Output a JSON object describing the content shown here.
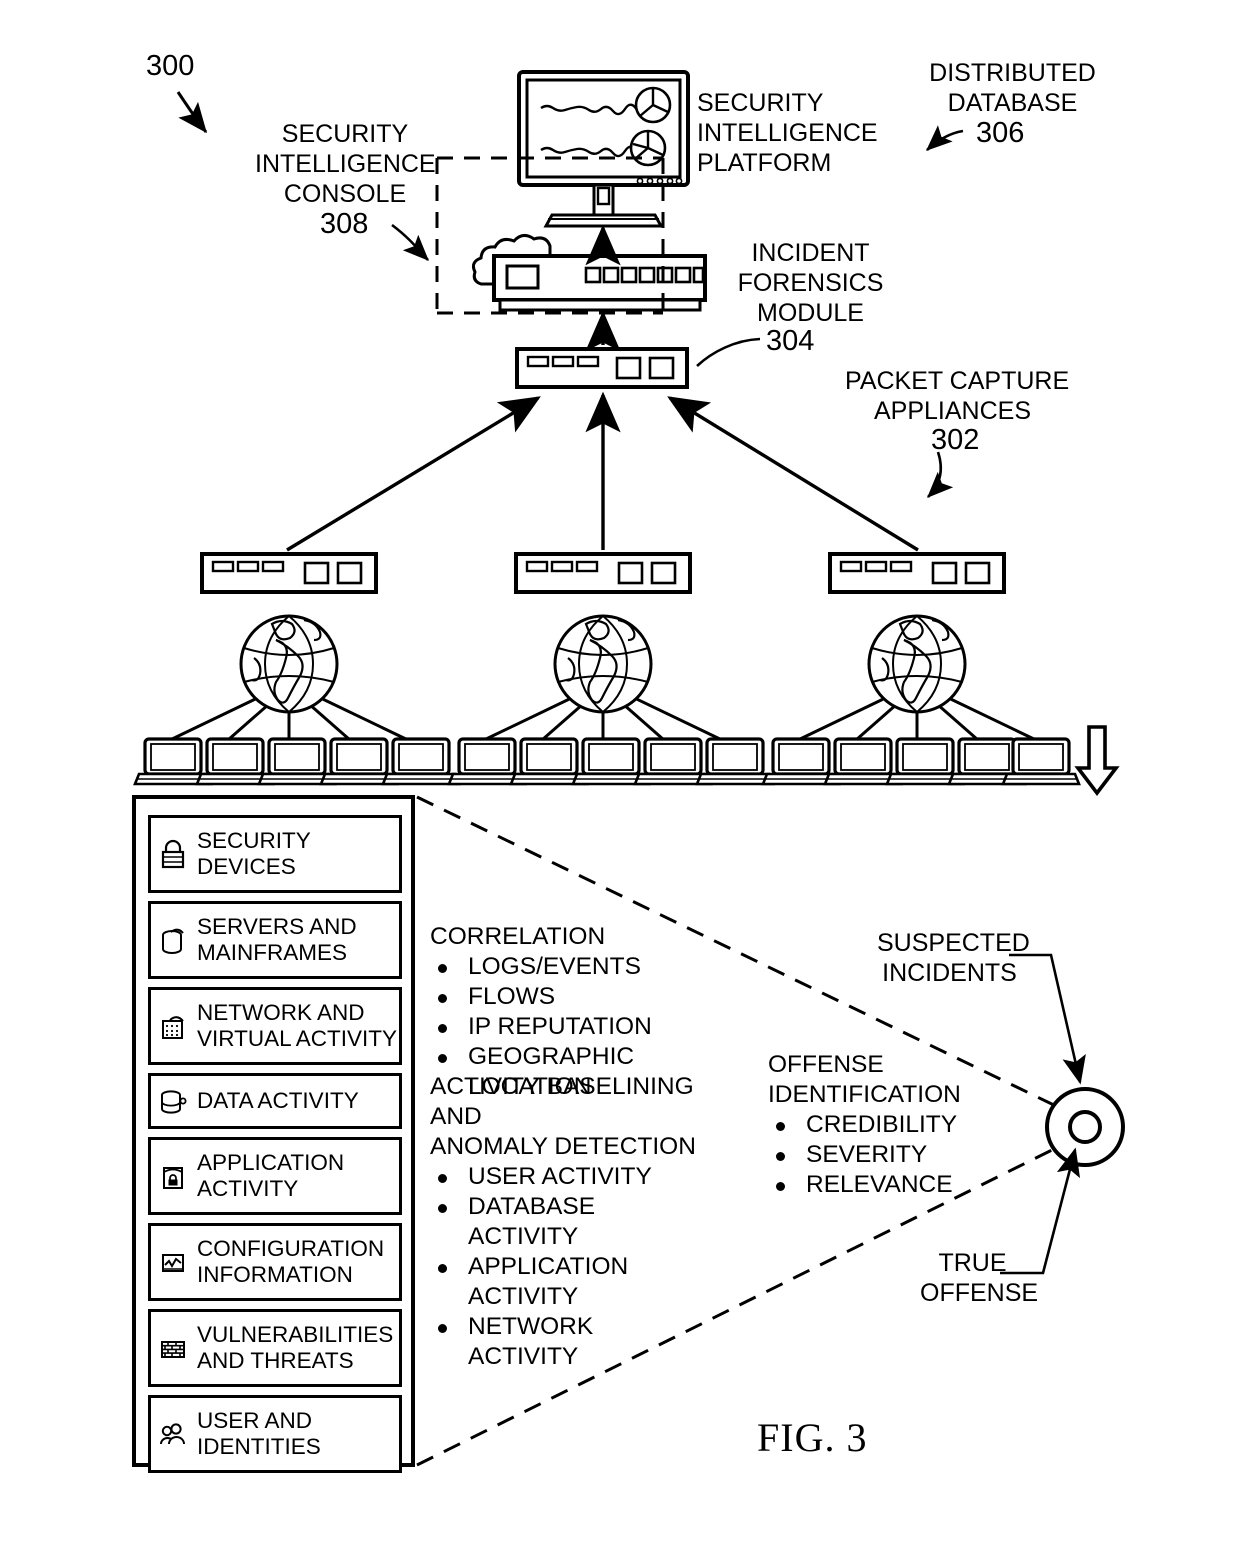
{
  "figure": {
    "number_label": "300",
    "caption": "FIG. 3"
  },
  "callouts": {
    "security_intelligence_console": {
      "label": "SECURITY\nINTELLIGENCE\nCONSOLE",
      "ref": "308"
    },
    "security_intelligence_platform": {
      "label": "SECURITY\nINTELLIGENCE\nPLATFORM"
    },
    "distributed_database": {
      "label": "DISTRIBUTED\nDATABASE",
      "ref": "306"
    },
    "incident_forensics_module": {
      "label": "INCIDENT\nFORENSICS\nMODULE",
      "ref": "304"
    },
    "packet_capture_appliances": {
      "label": "PACKET CAPTURE\nAPPLIANCES",
      "ref": "302"
    },
    "suspected_incidents": {
      "label": "SUSPECTED\nINCIDENTS"
    },
    "true_offense": {
      "label": "TRUE\nOFFENSE"
    }
  },
  "data_sources": {
    "items": [
      {
        "icon": "padlock-icon",
        "label": "SECURITY\nDEVICES"
      },
      {
        "icon": "server-cylinder-icon",
        "label": "SERVERS AND\nMAINFRAMES"
      },
      {
        "icon": "network-node-icon",
        "label": "NETWORK AND\nVIRTUAL ACTIVITY"
      },
      {
        "icon": "database-icon",
        "label": "DATA ACTIVITY"
      },
      {
        "icon": "application-lock-icon",
        "label": "APPLICATION\nACTIVITY"
      },
      {
        "icon": "chart-config-icon",
        "label": "CONFIGURATION\nINFORMATION"
      },
      {
        "icon": "brick-wall-icon",
        "label": "VULNERABILITIES\nAND THREATS"
      },
      {
        "icon": "users-group-icon",
        "label": "USER AND\nIDENTITIES"
      }
    ]
  },
  "analysis": {
    "correlation": {
      "heading": "CORRELATION",
      "bullets": [
        "LOGS/EVENTS",
        "FLOWS",
        "IP REPUTATION",
        "GEOGRAPHIC LOCATION"
      ]
    },
    "baselining": {
      "heading": "ACTIVITY BASELINING AND\nANOMALY DETECTION",
      "bullets": [
        "USER ACTIVITY",
        "DATABASE\nACTIVITY",
        "APPLICATION\nACTIVITY",
        "NETWORK\nACTIVITY"
      ]
    },
    "offense_identification": {
      "heading": "OFFENSE\nIDENTIFICATION",
      "bullets": [
        "CREDIBILITY",
        "SEVERITY",
        "RELEVANCE"
      ]
    }
  },
  "topology": {
    "globe_count": 3,
    "laptops_per_globe": 5,
    "packet_capture_appliance_count": 3
  },
  "colors": {
    "ink": "#000000",
    "paper": "#ffffff"
  }
}
